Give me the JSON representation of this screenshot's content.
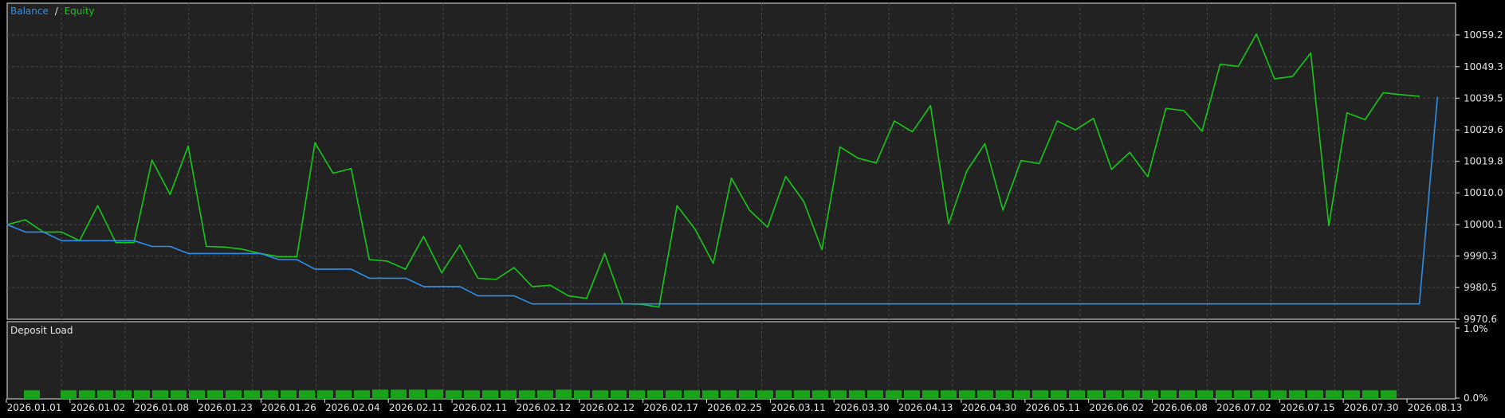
{
  "legend": {
    "balance_label": "Balance",
    "separator": "/",
    "equity_label": "Equity"
  },
  "colors": {
    "background": "#000000",
    "panel": "#222222",
    "frame": "#e6e6e6",
    "grid": "#4a4a4a",
    "text": "#e6e6e6",
    "balance": "#2f8fe8",
    "equity": "#18c818",
    "deposit_bar": "#1aa31a"
  },
  "chart_data": [
    {
      "type": "line",
      "title": "",
      "legend_position": "top-left",
      "grid": true,
      "ylim": [
        9970.6,
        10069.1
      ],
      "y_ticks": [
        "10059.2",
        "10049.3",
        "10039.5",
        "10029.6",
        "10019.8",
        "10010.0",
        "10000.1",
        "9990.3",
        "9980.5",
        "9970.6"
      ],
      "x_tick_labels": [
        "2026.01.01",
        "2026.01.02",
        "2026.01.08",
        "2026.01.23",
        "2026.01.26",
        "2026.02.04",
        "2026.02.11",
        "2026.02.11",
        "2026.02.12",
        "2026.02.12",
        "2026.02.17",
        "2026.02.25",
        "2026.03.11",
        "2026.03.30",
        "2026.04.13",
        "2026.04.30",
        "2026.05.11",
        "2026.06.02",
        "2026.06.08",
        "2026.07.02",
        "2026.07.15",
        "2026.07.30",
        "2026.08.13"
      ],
      "series": [
        {
          "name": "Balance",
          "values": [
            10000.1,
            9997.8,
            9997.8,
            9995.1,
            9995.1,
            9995.1,
            9995.1,
            9995.1,
            9993.3,
            9993.3,
            9991.1,
            9991.1,
            9991.1,
            9991.1,
            9991.1,
            9989.2,
            9989.2,
            9986.2,
            9986.2,
            9986.2,
            9983.4,
            9983.4,
            9983.4,
            9980.8,
            9980.8,
            9980.8,
            9977.9,
            9977.9,
            9977.9,
            9975.4,
            9975.4,
            9975.4,
            9975.4,
            9975.4,
            9975.4,
            9975.4,
            9975.4,
            9975.4,
            9975.4,
            9975.4,
            9975.4,
            9975.4,
            9975.4,
            9975.4,
            9975.4,
            9975.4,
            9975.4,
            9975.4,
            9975.4,
            9975.4,
            9975.4,
            9975.4,
            9975.4,
            9975.4,
            9975.4,
            9975.4,
            9975.4,
            9975.4,
            9975.4,
            9975.4,
            9975.4,
            9975.4,
            9975.4,
            9975.4,
            9975.4,
            9975.4,
            9975.4,
            9975.4,
            9975.4,
            9975.4,
            9975.4,
            9975.4,
            9975.4,
            9975.4,
            9975.4,
            9975.4,
            9975.4,
            9975.4,
            9975.4,
            10039.9
          ]
        },
        {
          "name": "Equity",
          "values": [
            10000.1,
            10001.6,
            9997.8,
            9997.8,
            9995.1,
            10006.0,
            9994.5,
            9994.5,
            10020.2,
            10009.5,
            10024.6,
            9993.3,
            9993.1,
            9992.4,
            9991.1,
            9990.1,
            9990.1,
            10025.6,
            10016.1,
            10017.6,
            9989.2,
            9988.7,
            9986.2,
            9996.4,
            9985.1,
            9993.7,
            9983.4,
            9983.0,
            9986.7,
            9980.8,
            9981.2,
            9977.9,
            9977.1,
            9991.1,
            9975.4,
            9975.3,
            9974.4,
            10006.0,
            9998.6,
            9988.0,
            10014.6,
            10004.6,
            9999.3,
            10015.1,
            10007.3,
            9992.3,
            10024.3,
            10020.8,
            10019.3,
            10032.4,
            10029.0,
            10037.2,
            10000.3,
            10016.8,
            10025.3,
            10004.6,
            10020.1,
            10019.1,
            10032.4,
            10029.6,
            10033.2,
            10017.3,
            10022.6,
            10015.0,
            10036.3,
            10035.6,
            10029.2,
            10050.1,
            10049.4,
            10059.5,
            10045.5,
            10046.3,
            10053.6,
            9999.8,
            10034.9,
            10032.8,
            10041.2,
            10040.6,
            10040.1
          ]
        }
      ]
    },
    {
      "type": "bar",
      "title": "Deposit Load",
      "legend_position": "top-left",
      "grid": true,
      "ylim": [
        0,
        1.0
      ],
      "y_ticks": [
        "1.0%",
        "0.0%"
      ],
      "values": [
        0.11,
        0,
        0.11,
        0.11,
        0.11,
        0.11,
        0.11,
        0.11,
        0.11,
        0.11,
        0.11,
        0.11,
        0.11,
        0.11,
        0.11,
        0.11,
        0.11,
        0.11,
        0.11,
        0.12,
        0.12,
        0.12,
        0.12,
        0.11,
        0.11,
        0.11,
        0.11,
        0.11,
        0.11,
        0.12,
        0.11,
        0.11,
        0.11,
        0.11,
        0.11,
        0.11,
        0.11,
        0.11,
        0.11,
        0.11,
        0.11,
        0.11,
        0.11,
        0.11,
        0.11,
        0.11,
        0.11,
        0.11,
        0.11,
        0.11,
        0.11,
        0.11,
        0.11,
        0.11,
        0.11,
        0.11,
        0.11,
        0.11,
        0.11,
        0.11,
        0.11,
        0.11,
        0.11,
        0.11,
        0.11,
        0.11,
        0.11,
        0.11,
        0.11,
        0.11,
        0.11,
        0.11,
        0.11,
        0.11,
        0.11
      ]
    }
  ]
}
